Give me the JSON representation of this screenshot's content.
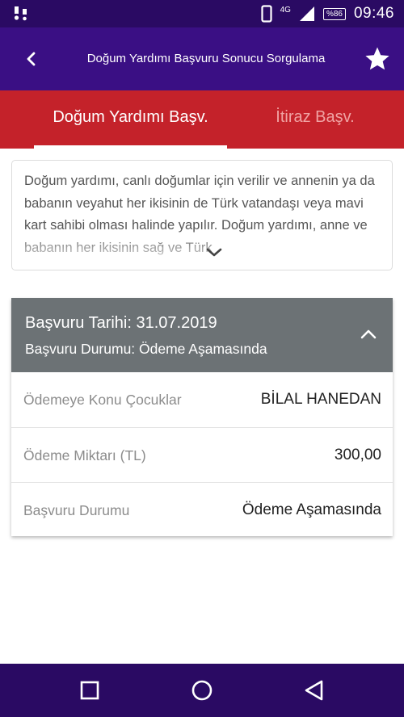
{
  "status_bar": {
    "network": "4G",
    "battery": "%86",
    "time": "09:46"
  },
  "app_bar": {
    "title": "Doğum Yardımı Başvuru Sonucu Sorgulama"
  },
  "tabs": [
    {
      "label": "Doğum Yardımı Başv.",
      "active": true
    },
    {
      "label": "İtiraz Başv.",
      "active": false
    }
  ],
  "description": {
    "text": "Doğum yardımı, canlı doğumlar için verilir ve annenin ya da babanın veyahut her ikisinin de Türk vatandaşı veya mavi kart sahibi olması halinde yapılır. Doğum yardımı, anne ve babanın her ikisinin sağ ve Türk"
  },
  "application": {
    "date_line": "Başvuru Tarihi: 31.07.2019",
    "status_line": "Başvuru Durumu: Ödeme Aşamasında",
    "rows": [
      {
        "label": "Ödemeye Konu Çocuklar",
        "value": "BİLAL HANEDAN"
      },
      {
        "label": "Ödeme Miktarı (TL)",
        "value": "300,00"
      },
      {
        "label": "Başvuru Durumu",
        "value": "Ödeme Aşamasında"
      }
    ]
  },
  "colors": {
    "status_bar": "#2a0a63",
    "app_bar": "#3a0f84",
    "tab_bar": "#c4222a",
    "card_header": "#6c7275"
  },
  "icons": {
    "status_left": "notification-footprints-icon",
    "phone": "phone-icon",
    "signal": "signal-icon",
    "back": "back-arrow-icon",
    "favorite": "star-icon",
    "expand": "chevron-down-icon",
    "collapse": "chevron-up-icon",
    "nav_recent": "square-icon",
    "nav_home": "circle-icon",
    "nav_back": "triangle-back-icon"
  }
}
